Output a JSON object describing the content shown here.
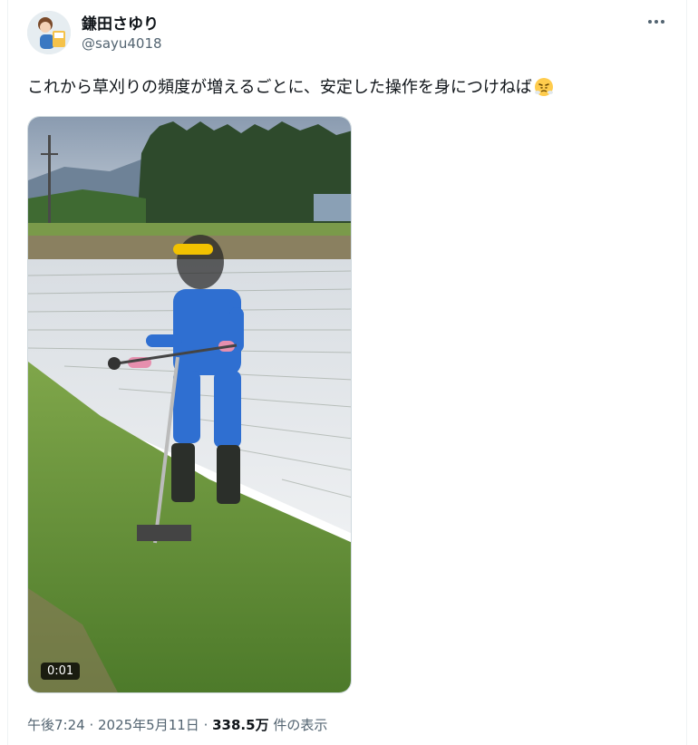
{
  "author": {
    "display_name": "鎌田さゆり",
    "handle": "@sayu4018"
  },
  "tweet": {
    "text": "これから草刈りの頻度が増えるごとに、安定した操作を身につけねば",
    "emoji_name": "face-with-steam-from-nose-emoji"
  },
  "media": {
    "duration": "0:01"
  },
  "meta": {
    "time": "午後7:24",
    "separator1": " · ",
    "date": "2025年5月11日",
    "separator2": " · ",
    "views_count": "338.5万",
    "views_label": " 件の表示"
  },
  "colors": {
    "text_primary": "#0f1419",
    "text_secondary": "#536471",
    "border": "#cfd9de"
  },
  "icons": {
    "more": "more-dots-icon"
  }
}
